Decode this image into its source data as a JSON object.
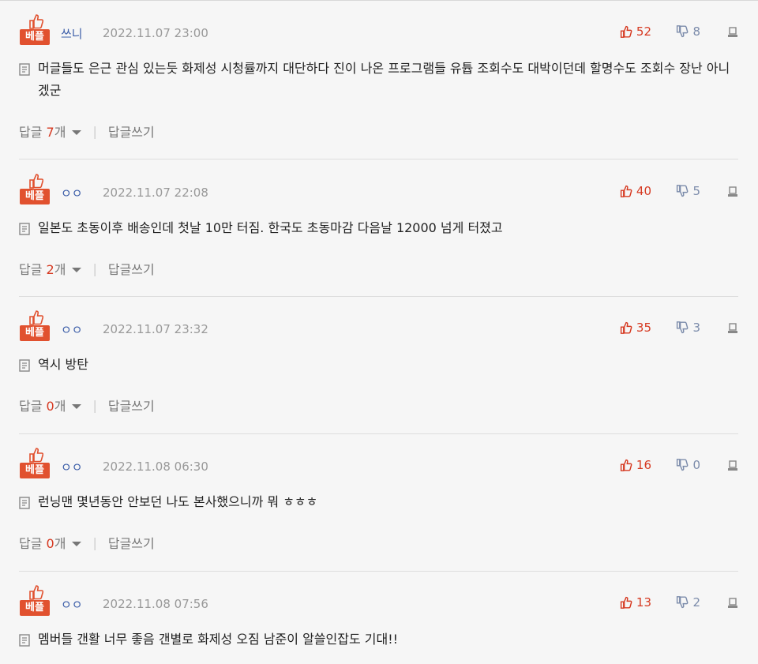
{
  "common": {
    "best_badge": "베플",
    "reply_prefix": "답글",
    "reply_suffix": "개",
    "write_reply": "답글쓰기",
    "separator": "|"
  },
  "comments": [
    {
      "author": "쓰니",
      "date": "2022.11.07 23:00",
      "likes": "52",
      "dislikes": "8",
      "text": "머글들도 은근 관심 있는듯 화제성 시청률까지 대단하다 진이 나온 프로그램들 유튭 조회수도 대박이던데 할명수도 조회수 장난 아니겠군",
      "reply_count": "7"
    },
    {
      "author": "ㅇㅇ",
      "date": "2022.11.07 22:08",
      "likes": "40",
      "dislikes": "5",
      "text": "일본도 초동이후 배송인데 첫날 10만 터짐. 한국도 초동마감 다음날 12000 넘게 터졌고",
      "reply_count": "2"
    },
    {
      "author": "ㅇㅇ",
      "date": "2022.11.07 23:32",
      "likes": "35",
      "dislikes": "3",
      "text": "역시 방탄",
      "reply_count": "0"
    },
    {
      "author": "ㅇㅇ",
      "date": "2022.11.08 06:30",
      "likes": "16",
      "dislikes": "0",
      "text": "런닝맨 몇년동안 안보던 나도 본사했으니까 뭐 ㅎㅎㅎ",
      "reply_count": "0"
    },
    {
      "author": "ㅇㅇ",
      "date": "2022.11.08 07:56",
      "likes": "13",
      "dislikes": "2",
      "text": "멤버들 갠활 너무 좋음 갠별로 화제성 오짐 남준이 알쓸인잡도 기대!!",
      "reply_count": ""
    }
  ],
  "colors": {
    "accent": "#e1512f",
    "like": "#d63a22",
    "dislike": "#7c8cab",
    "author": "#3b5da8"
  }
}
